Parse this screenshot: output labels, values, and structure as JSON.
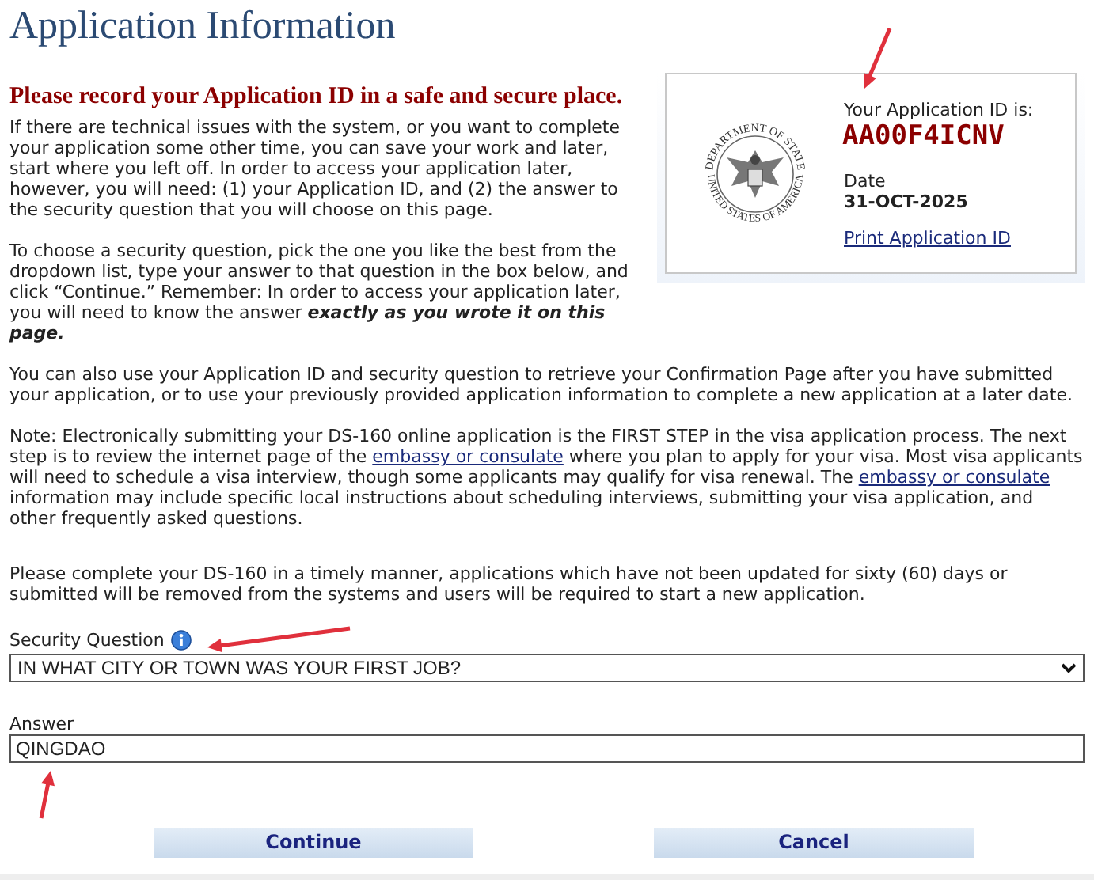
{
  "title": "Application Information",
  "notice": "Please record your Application ID in a safe and secure place.",
  "id_card": {
    "seal_top": "DEPARTMENT OF STATE",
    "seal_bottom": "UNITED STATES OF AMERICA",
    "id_label": "Your Application ID is:",
    "id_value": "AA00F4ICNV",
    "date_label": "Date",
    "date_value": "31-OCT-2025",
    "print_link": "Print Application ID"
  },
  "paragraphs": [
    [
      {
        "kind": "text",
        "text": "If there are technical issues with the system, or you want to complete your application some other time, you can save your work and later, start where you left off. In order to access your application later, however, you will need: (1) your Application ID, and (2) the answer to the security question that you will choose on this page."
      }
    ],
    [
      {
        "kind": "text",
        "text": "To choose a security question, pick the one you like the best from the dropdown list, type your answer to that question in the box below, and click “Continue.” Remember: In order to access your application later, you will need to know the answer "
      },
      {
        "kind": "strong",
        "text": "exactly as you wrote it on this page."
      }
    ],
    [
      {
        "kind": "text",
        "text": "You can also use your Application ID and security question to retrieve your Confirmation Page after you have submitted your application, or to use your previously provided application information to complete a new application at a later date."
      }
    ],
    [
      {
        "kind": "text",
        "text": "Note: Electronically submitting your DS-160 online application is the FIRST STEP in the visa application process. The next step is to review the internet page of the "
      },
      {
        "kind": "link",
        "text": "embassy or consulate"
      },
      {
        "kind": "text",
        "text": " where you plan to apply for your visa. Most visa applicants will need to schedule a visa interview, though some applicants may qualify for visa renewal. The "
      },
      {
        "kind": "link",
        "text": "embassy or consulate"
      },
      {
        "kind": "text",
        "text": " information may include specific local instructions about scheduling interviews, submitting your visa application, and other frequently asked questions."
      }
    ],
    [
      {
        "kind": "text",
        "text": "Please complete your DS-160 in a timely manner, applications which have not been updated for sixty (60) days or submitted will be removed from the systems and users will be required to start a new application."
      }
    ]
  ],
  "security_question": {
    "label": "Security Question",
    "value": "IN WHAT CITY OR TOWN WAS YOUR FIRST JOB?"
  },
  "answer": {
    "label": "Answer",
    "value": "QINGDAO"
  },
  "buttons": [
    "Continue",
    "Cancel"
  ]
}
